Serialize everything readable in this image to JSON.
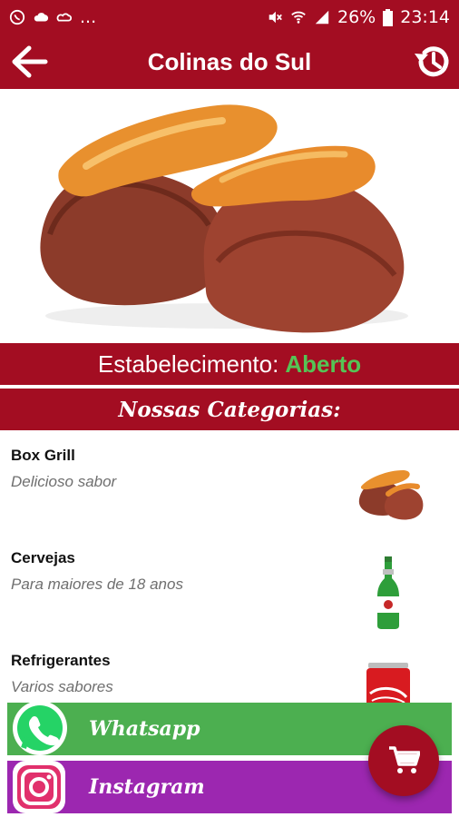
{
  "status_bar": {
    "time": "23:14",
    "battery": "26%",
    "dots": "..."
  },
  "app_bar": {
    "title": "Colinas do Sul"
  },
  "status_band": {
    "label": "Estabelecimento:",
    "state": "Aberto"
  },
  "categories_header": "Nossas Categorias:",
  "categories": [
    {
      "name": "Box Grill",
      "description": "Delicioso sabor",
      "image": "grilled-meat"
    },
    {
      "name": "Cervejas",
      "description": "Para maiores de 18 anos",
      "image": "beer-bottle"
    },
    {
      "name": "Refrigerantes",
      "description": "Varios sabores",
      "image": "soda-can"
    }
  ],
  "social": {
    "whatsapp_label": "Whatsapp",
    "instagram_label": "Instagram"
  },
  "colors": {
    "brand": "#a30d22",
    "open": "#55c455",
    "whatsapp": "#4caf50",
    "instagram": "#9c27b0"
  }
}
